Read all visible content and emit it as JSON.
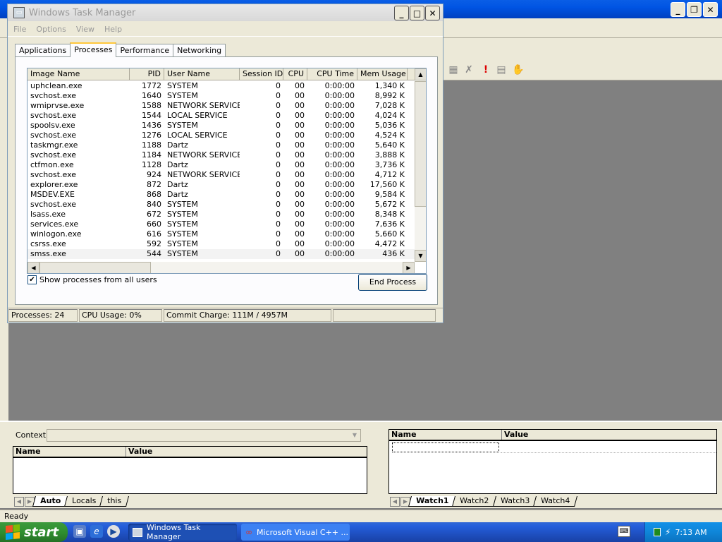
{
  "ide": {
    "debug_left": {
      "context_label": "Context:",
      "columns": [
        "Name",
        "Value"
      ],
      "tabs": [
        "Auto",
        "Locals",
        "this"
      ],
      "active_tab": "Auto"
    },
    "debug_right": {
      "columns": [
        "Name",
        "Value"
      ],
      "tabs": [
        "Watch1",
        "Watch2",
        "Watch3",
        "Watch4"
      ],
      "active_tab": "Watch1"
    },
    "status": "Ready"
  },
  "taskmanager": {
    "title": "Windows Task Manager",
    "menu": [
      "File",
      "Options",
      "View",
      "Help"
    ],
    "tabs": [
      "Applications",
      "Processes",
      "Performance",
      "Networking"
    ],
    "active_tab": "Processes",
    "columns": [
      "Image Name",
      "PID",
      "User Name",
      "Session ID",
      "CPU",
      "CPU Time",
      "Mem Usage"
    ],
    "processes": [
      [
        "uphclean.exe",
        "1772",
        "SYSTEM",
        "0",
        "00",
        "0:00:00",
        "1,340 K"
      ],
      [
        "svchost.exe",
        "1640",
        "SYSTEM",
        "0",
        "00",
        "0:00:00",
        "8,992 K"
      ],
      [
        "wmiprvse.exe",
        "1588",
        "NETWORK SERVICE",
        "0",
        "00",
        "0:00:00",
        "7,028 K"
      ],
      [
        "svchost.exe",
        "1544",
        "LOCAL SERVICE",
        "0",
        "00",
        "0:00:00",
        "4,024 K"
      ],
      [
        "spoolsv.exe",
        "1436",
        "SYSTEM",
        "0",
        "00",
        "0:00:00",
        "5,036 K"
      ],
      [
        "svchost.exe",
        "1276",
        "LOCAL SERVICE",
        "0",
        "00",
        "0:00:00",
        "4,524 K"
      ],
      [
        "taskmgr.exe",
        "1188",
        "Dartz",
        "0",
        "00",
        "0:00:00",
        "5,640 K"
      ],
      [
        "svchost.exe",
        "1184",
        "NETWORK SERVICE",
        "0",
        "00",
        "0:00:00",
        "3,888 K"
      ],
      [
        "ctfmon.exe",
        "1128",
        "Dartz",
        "0",
        "00",
        "0:00:00",
        "3,736 K"
      ],
      [
        "svchost.exe",
        "924",
        "NETWORK SERVICE",
        "0",
        "00",
        "0:00:00",
        "4,712 K"
      ],
      [
        "explorer.exe",
        "872",
        "Dartz",
        "0",
        "00",
        "0:00:00",
        "17,560 K"
      ],
      [
        "MSDEV.EXE",
        "868",
        "Dartz",
        "0",
        "00",
        "0:00:00",
        "9,584 K"
      ],
      [
        "svchost.exe",
        "840",
        "SYSTEM",
        "0",
        "00",
        "0:00:00",
        "5,672 K"
      ],
      [
        "lsass.exe",
        "672",
        "SYSTEM",
        "0",
        "00",
        "0:00:00",
        "8,348 K"
      ],
      [
        "services.exe",
        "660",
        "SYSTEM",
        "0",
        "00",
        "0:00:00",
        "7,636 K"
      ],
      [
        "winlogon.exe",
        "616",
        "SYSTEM",
        "0",
        "00",
        "0:00:00",
        "5,660 K"
      ],
      [
        "csrss.exe",
        "592",
        "SYSTEM",
        "0",
        "00",
        "0:00:00",
        "4,472 K"
      ],
      [
        "smss.exe",
        "544",
        "SYSTEM",
        "0",
        "00",
        "0:00:00",
        "436 K"
      ]
    ],
    "show_all_label": "Show processes from all users",
    "show_all_checked": true,
    "end_process_label": "End Process",
    "status": {
      "processes": "Processes: 24",
      "cpu": "CPU Usage: 0%",
      "commit": "Commit Charge: 111M / 4957M"
    }
  },
  "taskbar": {
    "start_label": "start",
    "buttons": [
      {
        "label": "Windows Task Manager",
        "icon": "taskmanager-icon"
      },
      {
        "label": "Microsoft Visual C++ ...",
        "icon": "visual-cpp-icon"
      }
    ],
    "clock": "7:13 AM"
  },
  "colors": {
    "xp_blue": "#245edb",
    "start_green": "#2f8f2f",
    "tray_blue": "#0f86d8"
  }
}
